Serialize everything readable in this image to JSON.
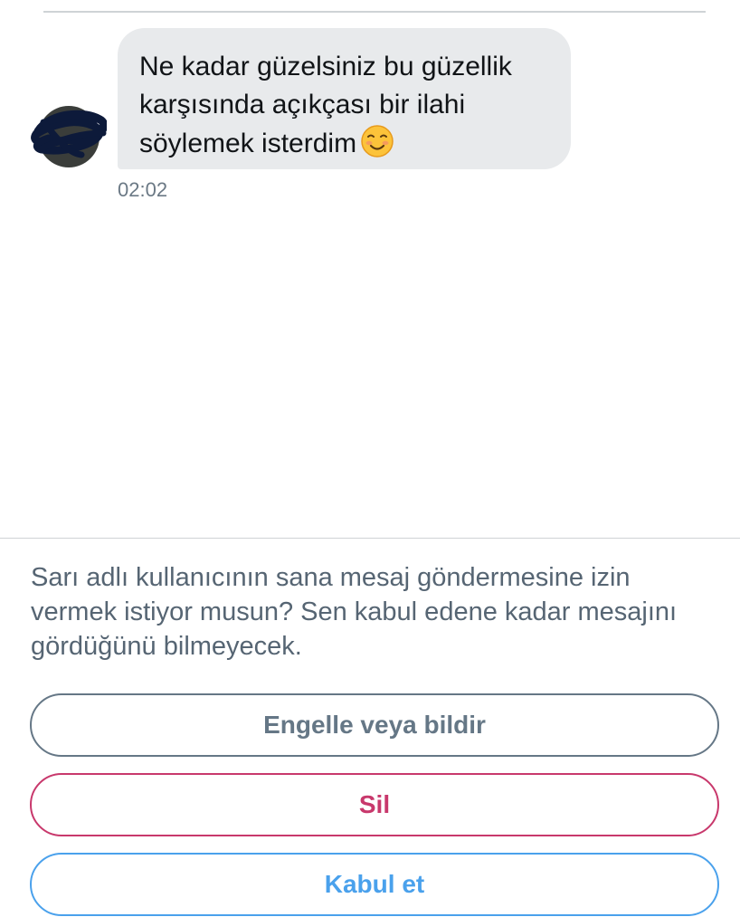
{
  "conversation": {
    "message": {
      "lines": [
        "Ne kadar güzelsiniz bu güzellik",
        "karşısında açıkçası bir ilahi",
        "söylemek isterdim"
      ],
      "emoji": "smiling-face-icon",
      "time": "02:02"
    }
  },
  "request": {
    "prompt": "Sarı adlı kullanıcının sana mesaj göndermesine izin vermek istiyor musun? Sen kabul edene kadar mesajını gördüğünü bilmeyecek.",
    "block_report_label": "Engelle veya bildir",
    "delete_label": "Sil",
    "accept_label": "Kabul et"
  },
  "colors": {
    "bubble_bg": "#e8eaec",
    "muted_text": "#657786",
    "danger": "#c8386c",
    "accent": "#4aa1ec"
  }
}
